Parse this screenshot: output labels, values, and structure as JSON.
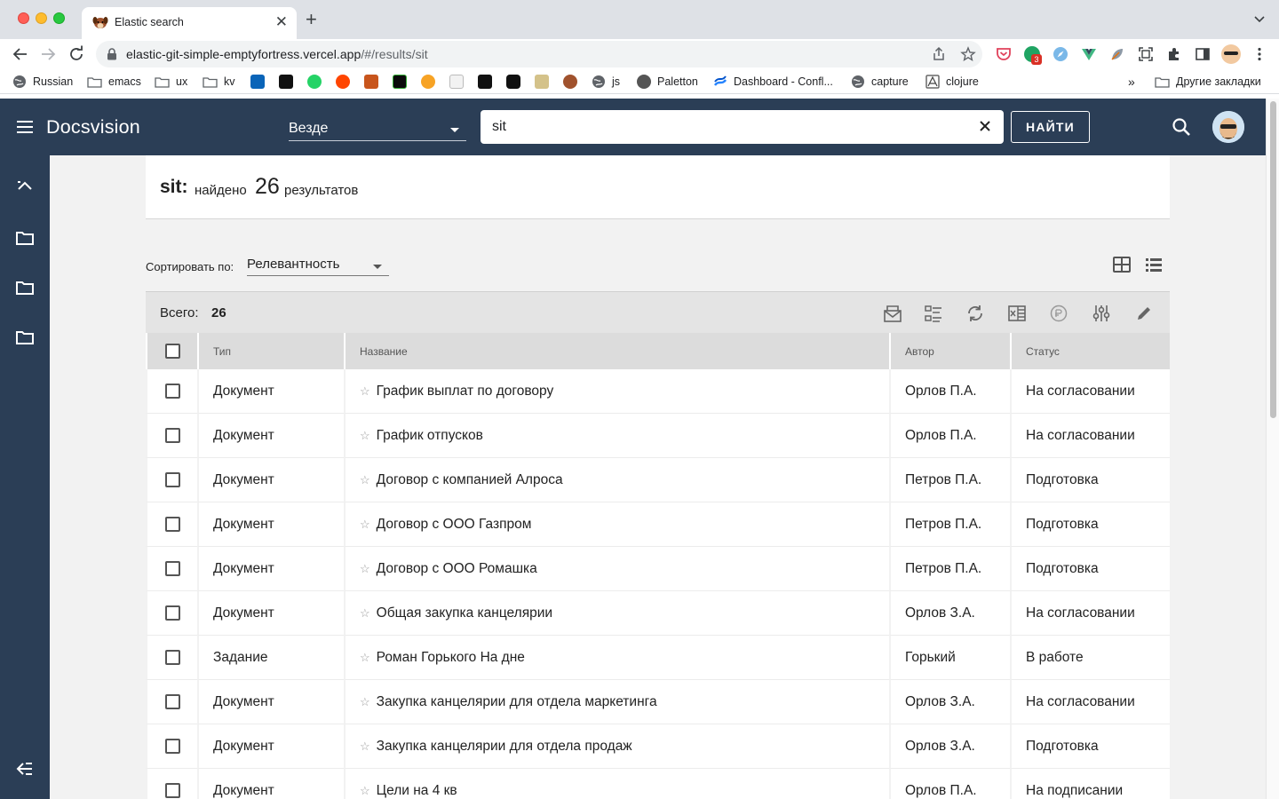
{
  "browser": {
    "tab_title": "Elastic search",
    "url_host": "elastic-git-simple-emptyfortress.vercel.app",
    "url_path": "/#/results/sit",
    "extension_badge": "3",
    "bookmarks": [
      {
        "label": "Russian",
        "icon": "globe-icon"
      },
      {
        "label": "emacs",
        "icon": "folder-icon"
      },
      {
        "label": "ux",
        "icon": "folder-icon"
      },
      {
        "label": "kv",
        "icon": "folder-icon"
      },
      {
        "label": "js",
        "icon": "globe-icon"
      },
      {
        "label": "Paletton",
        "icon": "paletton-icon"
      },
      {
        "label": "Dashboard - Confl...",
        "icon": "confluence-icon"
      },
      {
        "label": "capture",
        "icon": "globe-icon"
      },
      {
        "label": "clojure",
        "icon": "clojure-icon"
      }
    ],
    "bookmarks_overflow": "»",
    "other_bookmarks": "Другие закладки"
  },
  "app": {
    "brand": "Docsvision",
    "scope": "Везде",
    "search_value": "sit",
    "find_button": "НАЙТИ"
  },
  "results_header": {
    "term": "sit:",
    "found": "найдено",
    "count": "26",
    "results_word": "результатов"
  },
  "sort": {
    "label": "Сортировать по:",
    "value": "Релевантность"
  },
  "total": {
    "label": "Всего:",
    "count": "26"
  },
  "table": {
    "columns": [
      "Тип",
      "Название",
      "Автор",
      "Статус"
    ],
    "rows": [
      {
        "type": "Документ",
        "name": "График выплат по договору",
        "author": "Орлов П.А.",
        "status": "На согласовании"
      },
      {
        "type": "Документ",
        "name": "График отпусков",
        "author": "Орлов П.А.",
        "status": "На согласовании"
      },
      {
        "type": "Документ",
        "name": "Договор с компанией Алроса",
        "author": "Петров П.А.",
        "status": "Подготовка"
      },
      {
        "type": "Документ",
        "name": "Договор с ООО Газпром",
        "author": "Петров П.А.",
        "status": "Подготовка"
      },
      {
        "type": "Документ",
        "name": "Договор с ООО Ромашка",
        "author": "Петров П.А.",
        "status": "Подготовка"
      },
      {
        "type": "Документ",
        "name": "Общая закупка канцелярии",
        "author": "Орлов З.А.",
        "status": "На согласовании"
      },
      {
        "type": "Задание",
        "name": "Роман Горького На дне",
        "author": "Горький",
        "status": "В работе"
      },
      {
        "type": "Документ",
        "name": "Закупка канцелярии для отдела маркетинга",
        "author": "Орлов З.А.",
        "status": "На согласовании"
      },
      {
        "type": "Документ",
        "name": "Закупка канцелярии для отдела продаж",
        "author": "Орлов З.А.",
        "status": "Подготовка"
      },
      {
        "type": "Документ",
        "name": "Цели на 4 кв",
        "author": "Орлов П.А.",
        "status": "На подписании"
      }
    ]
  },
  "colors": {
    "appbar": "#2b3e56",
    "content_bg": "#f2f2f2",
    "table_header": "#dcdcdc",
    "total_bar": "#e4e4e4"
  }
}
